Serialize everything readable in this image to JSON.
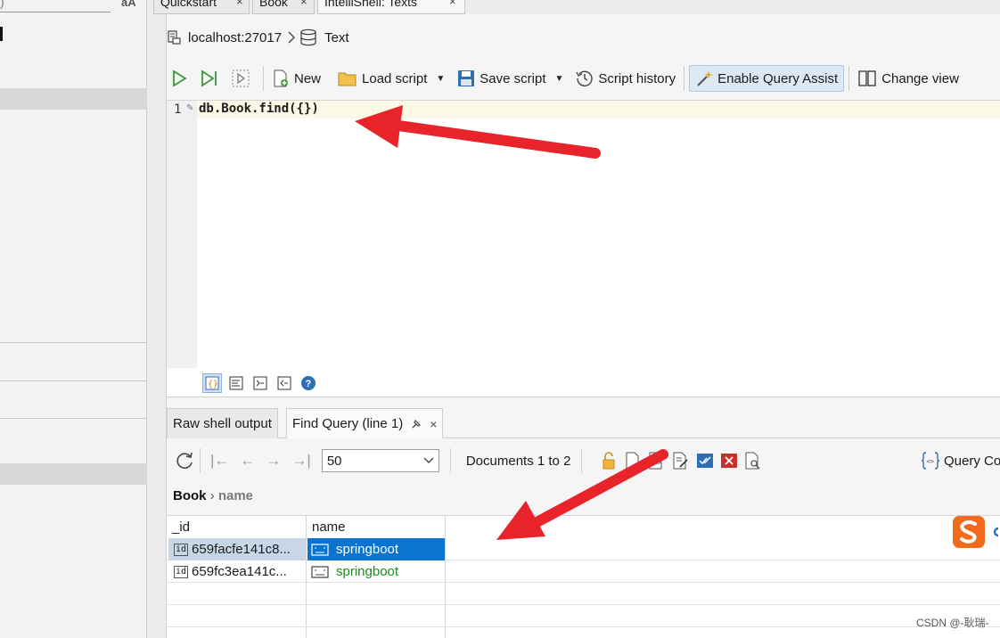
{
  "sidebar": {
    "search_fragment": ")",
    "font_toggle_label": "aA"
  },
  "tabs": [
    {
      "label": "Quickstart",
      "close": "×"
    },
    {
      "label": "Book",
      "close": "×"
    },
    {
      "label": "IntelliShell: Texts",
      "close": "×"
    }
  ],
  "breadcrumb": {
    "connection": "localhost:27017",
    "database": "Text"
  },
  "toolbar": {
    "new_label": "New",
    "load_label": "Load script",
    "save_label": "Save script",
    "history_label": "Script history",
    "assist_label": "Enable Query Assist",
    "change_view_label": "Change view"
  },
  "editor": {
    "line_number": "1",
    "code": "db.Book.find({})"
  },
  "result_tabs": {
    "raw_label": "Raw shell output",
    "find_label": "Find Query (line 1)",
    "close": "×"
  },
  "result_toolbar": {
    "page_size": "50",
    "documents_label": "Documents 1 to 2",
    "query_code_label": "Query Co"
  },
  "result_breadcrumb": {
    "collection": "Book",
    "field": "name"
  },
  "table": {
    "columns": [
      "_id",
      "name"
    ],
    "id_tag": "id",
    "rows": [
      {
        "id": "659facfe141c8...",
        "name": "springboot"
      },
      {
        "id": "659fc3ea141c...",
        "name": "springboot"
      }
    ]
  },
  "watermark": "CSDN @-耿瑞-",
  "colors": {
    "accent": "#0b74d1",
    "arrow": "#e8232a",
    "string_value": "#1d8a1d",
    "assist_bg": "#dde8f5"
  }
}
